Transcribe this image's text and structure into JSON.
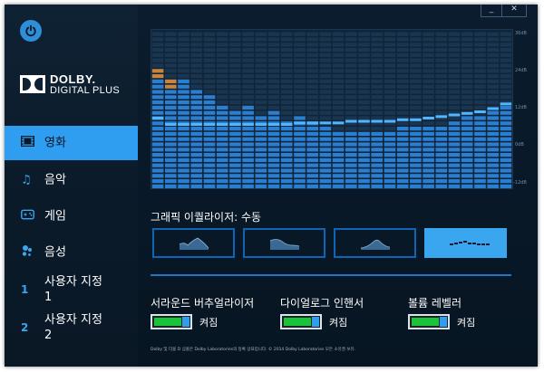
{
  "window": {
    "minimize_label": "_",
    "close_label": "✕"
  },
  "sidebar": {
    "power_icon": "power-icon",
    "logo": {
      "line1": "DOLBY.",
      "line2": "DIGITAL PLUS"
    },
    "items": [
      {
        "label": "영화",
        "icon": "film-icon",
        "active": true
      },
      {
        "label": "음악",
        "icon": "music-note-icon",
        "active": false
      },
      {
        "label": "게임",
        "icon": "gamepad-icon",
        "active": false
      },
      {
        "label": "음성",
        "icon": "voice-icon",
        "active": false
      },
      {
        "label": "사용자 지정\n1",
        "icon": "number-1-icon",
        "icon_text": "1",
        "active": false
      },
      {
        "label": "사용자 지정\n2",
        "icon": "number-2-icon",
        "icon_text": "2",
        "active": false
      }
    ]
  },
  "equalizer": {
    "db_labels": [
      "36dB",
      "24dB",
      "12dB",
      "0dB",
      "-12dB"
    ],
    "title": "그래픽 이퀄라이저: 수동",
    "band_levels": [
      0.78,
      0.73,
      0.7,
      0.66,
      0.6,
      0.56,
      0.53,
      0.56,
      0.49,
      0.53,
      0.46,
      0.47,
      0.44,
      0.42,
      0.39,
      0.38,
      0.38,
      0.39,
      0.39,
      0.4,
      0.41,
      0.42,
      0.43,
      0.45,
      0.47,
      0.49,
      0.51,
      0.55
    ],
    "current_levels": [
      0.44,
      0.4,
      0.4,
      0.4,
      0.4,
      0.4,
      0.4,
      0.4,
      0.4,
      0.4,
      0.4,
      0.41,
      0.41,
      0.41,
      0.41,
      0.42,
      0.42,
      0.42,
      0.42,
      0.43,
      0.43,
      0.44,
      0.45,
      0.46,
      0.47,
      0.48,
      0.5,
      0.53
    ],
    "presets": [
      {
        "name": "preset-open",
        "active": false
      },
      {
        "name": "preset-rich",
        "active": false
      },
      {
        "name": "preset-focused",
        "active": false
      },
      {
        "name": "preset-manual",
        "active": true
      }
    ]
  },
  "features": [
    {
      "title": "서라운드 버추얼라이저",
      "state": "켜짐",
      "on": true
    },
    {
      "title": "다이얼로그 인핸서",
      "state": "켜짐",
      "on": true
    },
    {
      "title": "볼륨 레벨러",
      "state": "켜짐",
      "on": true
    }
  ],
  "footer": "Dolby 및 더블 D 심볼은 Dolby Laboratories의 등록 상표입니다. © 2014 Dolby Laboratories 모든 소유권 보유.",
  "colors": {
    "accent": "#2f9ef0",
    "toggle_on": "#19c33a",
    "bar_peak": "#c8843a",
    "bar_base": "#2b7fd1"
  }
}
